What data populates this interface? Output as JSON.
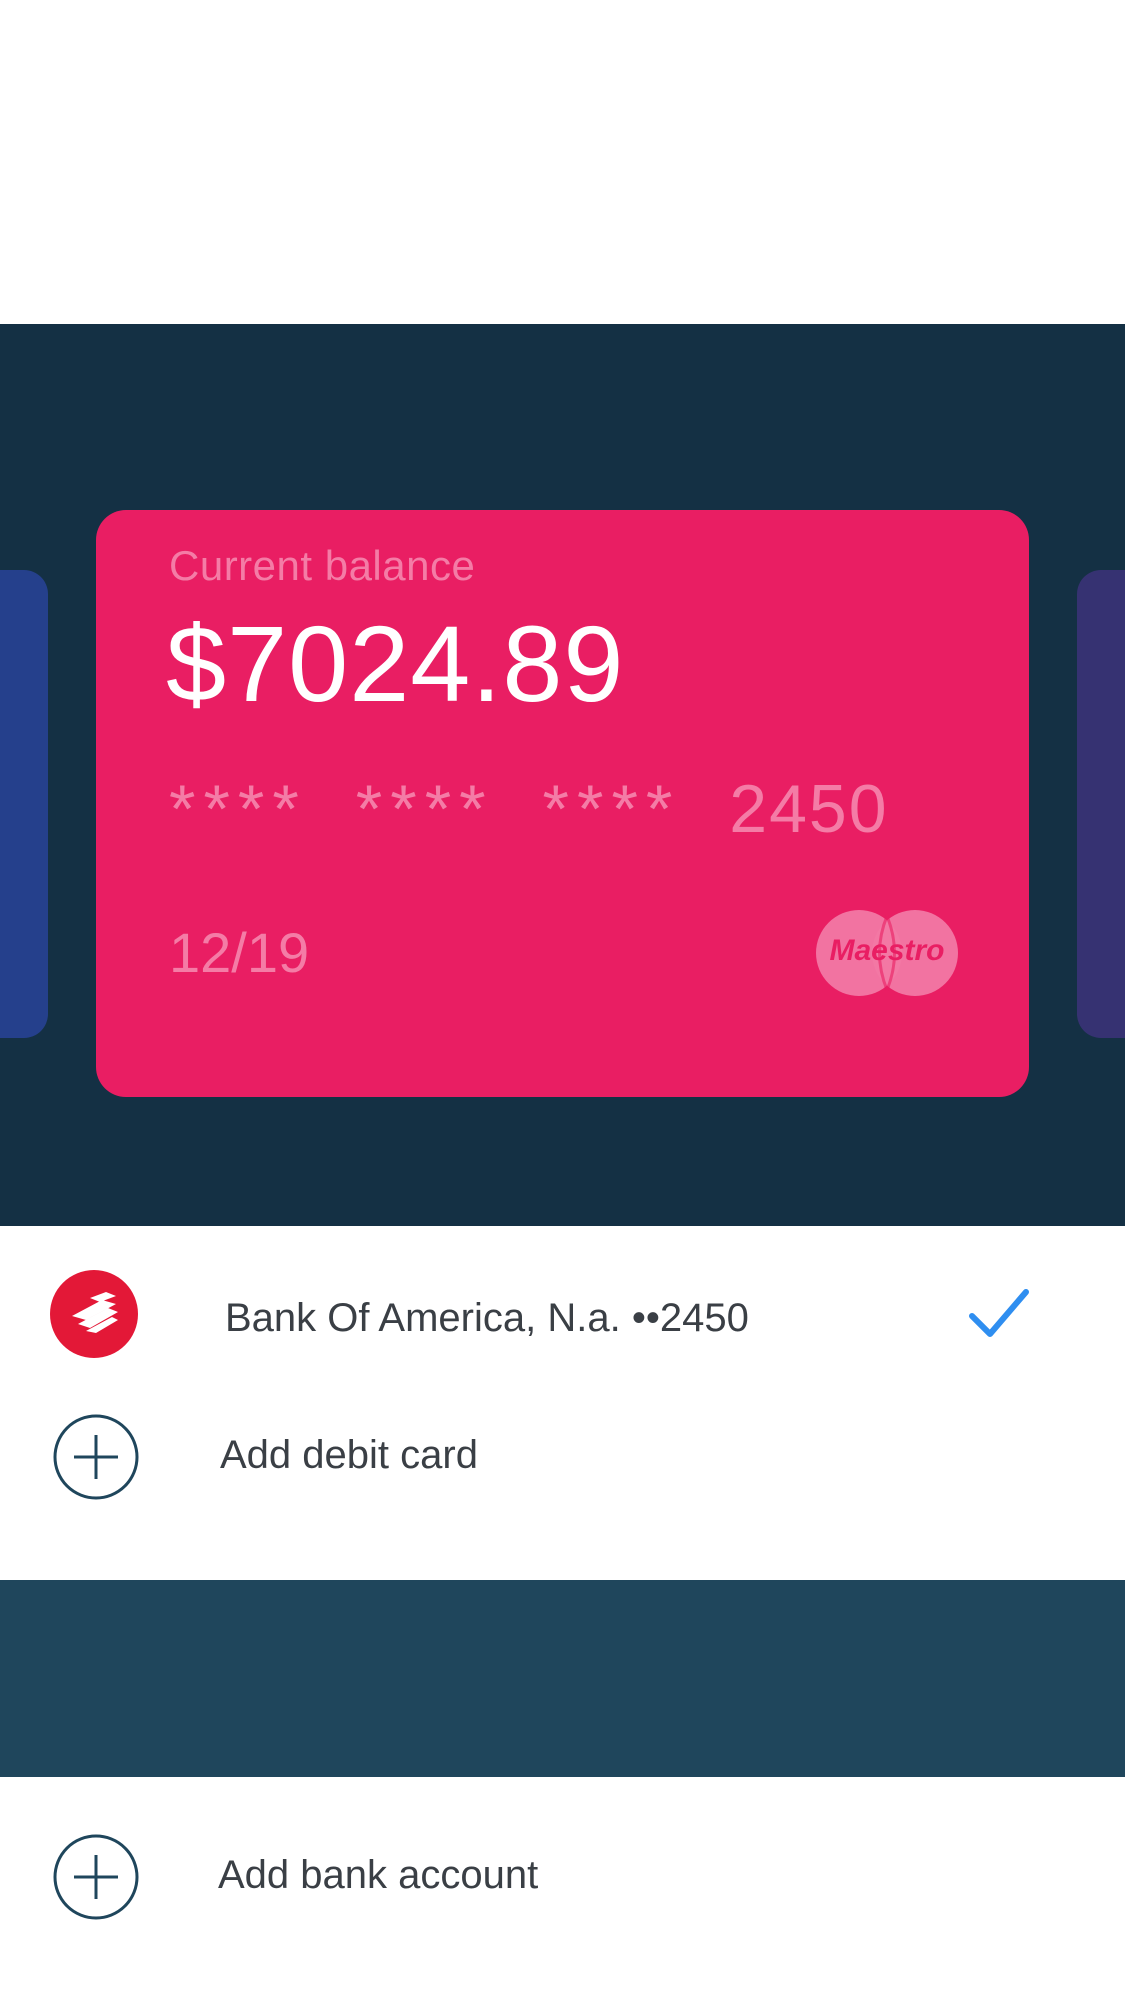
{
  "card": {
    "balance_label": "Current balance",
    "balance": "$7024.89",
    "number_groups": [
      "****",
      "****",
      "****"
    ],
    "number_last": "2450",
    "expiry": "12/19",
    "network": "Maestro",
    "color": "#e91e63"
  },
  "accounts": {
    "bank": {
      "name": "Bank Of America, N.a. ••2450",
      "icon": "bank-of-america-logo",
      "selected_icon": "checkmark-icon",
      "color": "#e31837"
    },
    "add_debit_label": "Add debit card",
    "add_bank_label": "Add bank account"
  },
  "colors": {
    "card_area_bg": "#143044",
    "band_bg": "#1f465c",
    "check": "#2f8ef0"
  }
}
